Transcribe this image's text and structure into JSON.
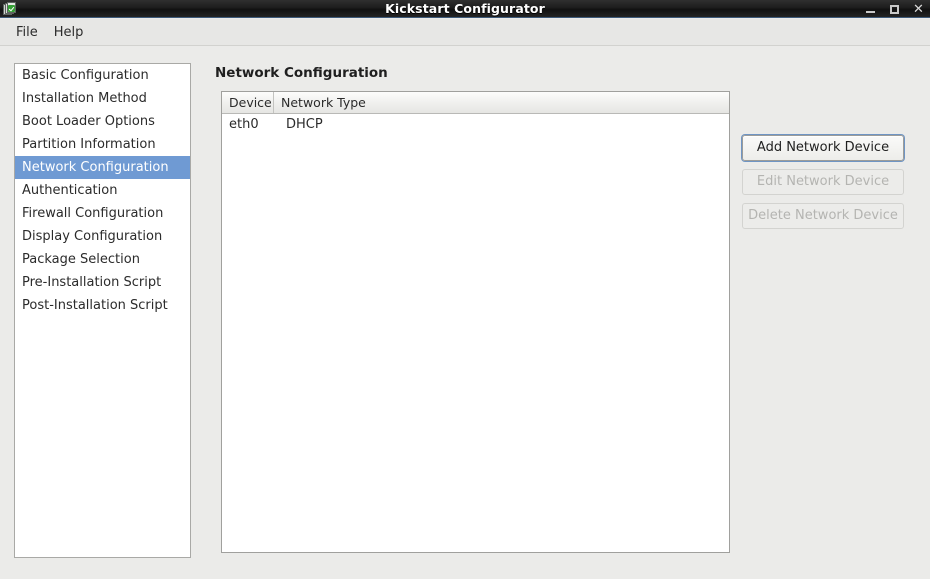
{
  "window": {
    "title": "Kickstart Configurator",
    "icon": "kickstart-app-icon",
    "controls": {
      "minimize": "minimize-icon",
      "maximize": "maximize-icon",
      "close": "✕"
    }
  },
  "menubar": {
    "items": [
      {
        "label": "File"
      },
      {
        "label": "Help"
      }
    ]
  },
  "sidebar": {
    "items": [
      {
        "label": "Basic Configuration",
        "selected": false
      },
      {
        "label": "Installation Method",
        "selected": false
      },
      {
        "label": "Boot Loader Options",
        "selected": false
      },
      {
        "label": "Partition Information",
        "selected": false
      },
      {
        "label": "Network Configuration",
        "selected": true
      },
      {
        "label": "Authentication",
        "selected": false
      },
      {
        "label": "Firewall Configuration",
        "selected": false
      },
      {
        "label": "Display Configuration",
        "selected": false
      },
      {
        "label": "Package Selection",
        "selected": false
      },
      {
        "label": "Pre-Installation Script",
        "selected": false
      },
      {
        "label": "Post-Installation Script",
        "selected": false
      }
    ]
  },
  "content": {
    "heading": "Network Configuration",
    "table": {
      "columns": [
        "Device",
        "Network Type"
      ],
      "rows": [
        {
          "device": "eth0",
          "network_type": "DHCP"
        }
      ]
    },
    "buttons": [
      {
        "label": "Add Network Device",
        "enabled": true
      },
      {
        "label": "Edit Network Device",
        "enabled": false
      },
      {
        "label": "Delete Network Device",
        "enabled": false
      }
    ]
  },
  "colors": {
    "selection_blue": "#6f9ad3",
    "window_background": "#ebebe9",
    "titlebar_dark": "#1d1d1d",
    "focus_ring": "#6f95c4"
  }
}
